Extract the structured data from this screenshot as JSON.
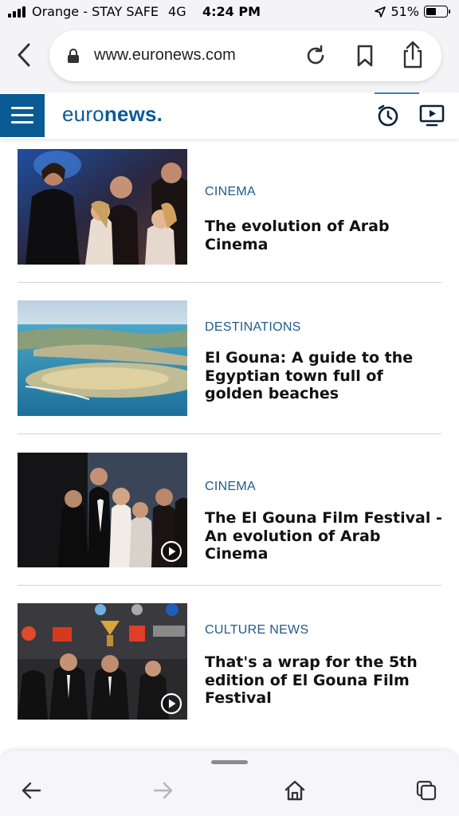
{
  "status_bar": {
    "carrier": "Orange - STAY SAFE",
    "network": "4G",
    "time": "4:24 PM",
    "battery_percent": "51%",
    "battery_level": 0.51,
    "location_icon": "location-arrow-icon"
  },
  "browser": {
    "url": "www.euronews.com",
    "icons": [
      "back-arrow-icon",
      "lock-icon",
      "reload-icon",
      "bookmark-icon",
      "share-icon"
    ]
  },
  "site_header": {
    "logo_light": "euro",
    "logo_bold": "news.",
    "icons": [
      "hamburger-menu-icon",
      "clock-icon",
      "tv-play-icon"
    ],
    "brand_color": "#0a5a94"
  },
  "articles": [
    {
      "category": "CINEMA",
      "headline": "The evolution of Arab Cinema",
      "has_video": false
    },
    {
      "category": "DESTINATIONS",
      "headline": "El Gouna: A guide to the Egyptian town full of golden beaches",
      "has_video": false
    },
    {
      "category": "CINEMA",
      "headline": "The El Gouna Film Festival - An evolution of Arab Cinema",
      "has_video": true
    },
    {
      "category": "CULTURE NEWS",
      "headline": "That's a wrap for the 5th edition of El Gouna Film Festival",
      "has_video": true
    }
  ],
  "toolbar": {
    "icons": [
      "back-arrow-icon",
      "forward-arrow-icon",
      "home-icon",
      "tabs-icon"
    ]
  }
}
